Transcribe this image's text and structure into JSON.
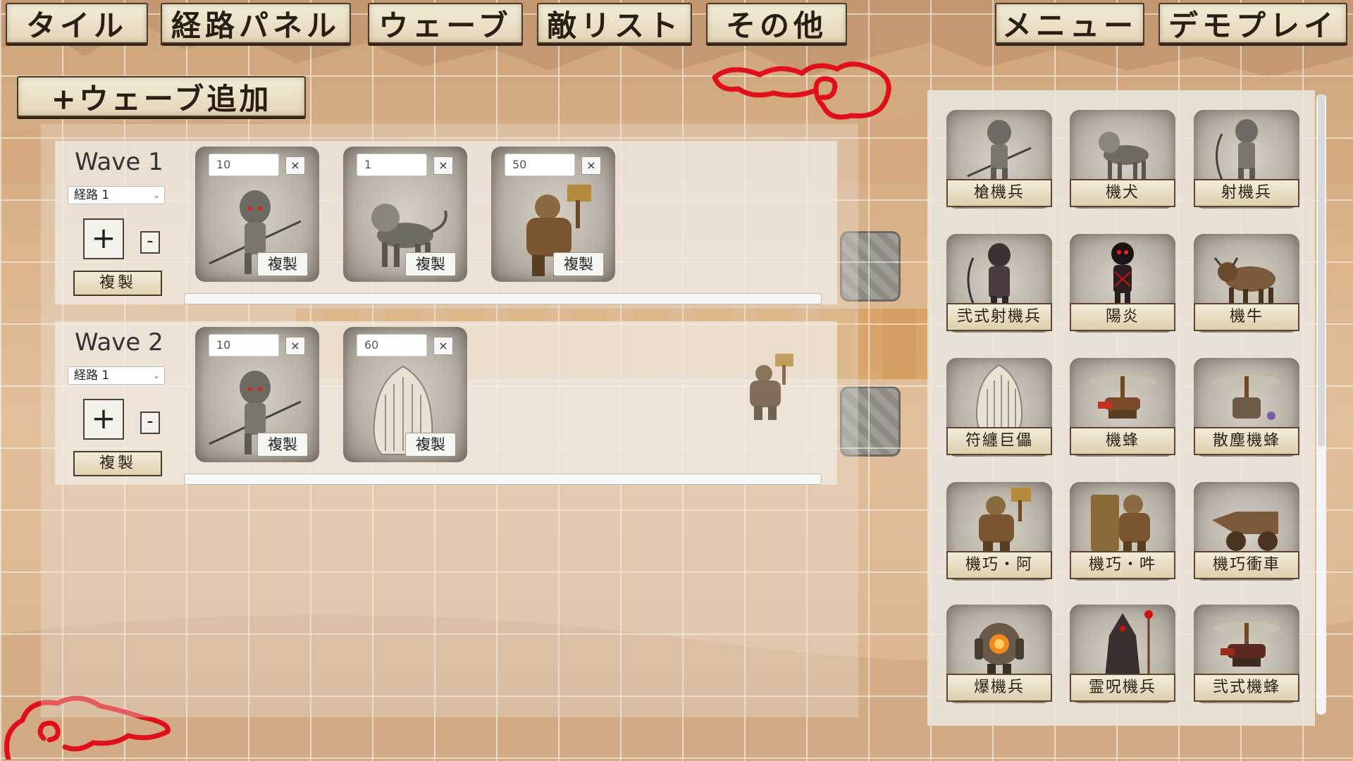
{
  "topbar": {
    "tabs": [
      "タイル",
      "経路パネル",
      "ウェーブ",
      "敵リスト",
      "その他"
    ],
    "menu_label": "メニュー",
    "demo_label": "デモプレイ"
  },
  "add_wave_label": "+ウェーブ追加",
  "waves": [
    {
      "title": "Wave 1",
      "route": "経路 1",
      "plus": "+",
      "minus": "-",
      "duplicate": "複製",
      "enemies": [
        {
          "count": "10",
          "remove": "×",
          "duplicate": "複製",
          "icon": "spear-soldier-icon"
        },
        {
          "count": "1",
          "remove": "×",
          "duplicate": "複製",
          "icon": "mech-dog-icon"
        },
        {
          "count": "50",
          "remove": "×",
          "duplicate": "複製",
          "icon": "hammer-golem-icon"
        }
      ]
    },
    {
      "title": "Wave 2",
      "route": "経路 1",
      "plus": "+",
      "minus": "-",
      "duplicate": "複製",
      "enemies": [
        {
          "count": "10",
          "remove": "×",
          "duplicate": "複製",
          "icon": "spear-soldier-icon"
        },
        {
          "count": "60",
          "remove": "×",
          "duplicate": "複製",
          "icon": "talisman-giant-icon"
        }
      ]
    }
  ],
  "enemy_palette": [
    {
      "label": "槍機兵",
      "icon": "spear-soldier-icon"
    },
    {
      "label": "機犬",
      "icon": "mech-dog-icon"
    },
    {
      "label": "射機兵",
      "icon": "archer-soldier-icon"
    },
    {
      "label": "弐式射機兵",
      "icon": "dark-archer-icon"
    },
    {
      "label": "陽炎",
      "icon": "heat-shimmer-icon"
    },
    {
      "label": "機牛",
      "icon": "mech-bull-icon"
    },
    {
      "label": "符纏巨儡",
      "icon": "talisman-giant-icon"
    },
    {
      "label": "機蜂",
      "icon": "mech-bee-icon"
    },
    {
      "label": "散塵機蜂",
      "icon": "dust-bee-icon"
    },
    {
      "label": "機巧・阿",
      "icon": "hammer-golem-icon"
    },
    {
      "label": "機巧・吽",
      "icon": "shield-golem-icon"
    },
    {
      "label": "機巧衝車",
      "icon": "battering-ram-icon"
    },
    {
      "label": "爆機兵",
      "icon": "bomb-soldier-icon"
    },
    {
      "label": "霊呪機兵",
      "icon": "curse-mage-icon"
    },
    {
      "label": "弐式機蜂",
      "icon": "mech-bee-mk2-icon"
    }
  ],
  "colors": {
    "accent_red": "#e0101a",
    "button_face": "#efe4cc",
    "button_border": "#4a3a28"
  }
}
